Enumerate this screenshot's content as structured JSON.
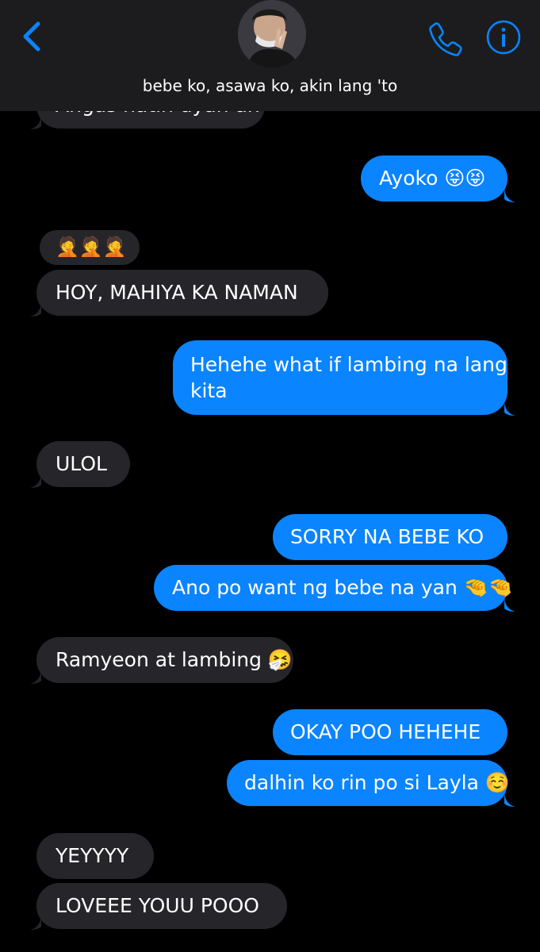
{
  "header": {
    "contact_name": "bebe ko, asawa ko, akin lang 'to"
  },
  "messages": [
    {
      "id": "m0",
      "direction": "incoming",
      "text": "Angas natin dyan ah",
      "partially_visible": true
    },
    {
      "id": "m1",
      "direction": "outgoing",
      "text": "Ayoko 😝😝"
    },
    {
      "id": "m2",
      "direction": "incoming",
      "text": "🤦🤦🤦"
    },
    {
      "id": "m3",
      "direction": "incoming",
      "text": "HOY, MAHIYA KA NAMAN"
    },
    {
      "id": "m4",
      "direction": "outgoing",
      "lines": [
        "Hehehe what if lambing na lang",
        "kita"
      ]
    },
    {
      "id": "m5",
      "direction": "incoming",
      "text": "ULOL"
    },
    {
      "id": "m6",
      "direction": "outgoing",
      "text": "SORRY NA BEBE KO"
    },
    {
      "id": "m7",
      "direction": "outgoing",
      "text": "Ano po want ng bebe na yan 🤏🤏"
    },
    {
      "id": "m8",
      "direction": "incoming",
      "text": "Ramyeon at lambing 🤧"
    },
    {
      "id": "m9",
      "direction": "outgoing",
      "text": "OKAY POO HEHEHE"
    },
    {
      "id": "m10",
      "direction": "outgoing",
      "text": "dalhin ko rin po si Layla ☺️"
    },
    {
      "id": "m11",
      "direction": "incoming",
      "text": "YEYYYY"
    },
    {
      "id": "m12",
      "direction": "incoming",
      "text": "LOVEEE YOUU POOO"
    }
  ],
  "icons": {
    "back": "chevron-left-icon",
    "call": "phone-icon",
    "info": "info-icon",
    "avatar": "contact-avatar"
  },
  "colors": {
    "background": "#000000",
    "header": "#1c1c1e",
    "incoming_bubble": "#26252a",
    "outgoing_bubble": "#0a84ff",
    "accent": "#0a84ff",
    "text": "#ffffff"
  }
}
